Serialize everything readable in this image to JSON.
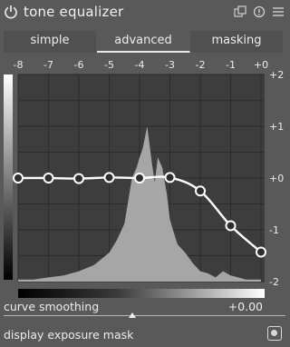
{
  "module": {
    "title": "tone equalizer"
  },
  "header_icons": [
    "power-icon",
    "presets-icon",
    "reset-icon",
    "menu-icon"
  ],
  "tabs": [
    {
      "label": "simple",
      "active": false
    },
    {
      "label": "advanced",
      "active": true
    },
    {
      "label": "masking",
      "active": false
    }
  ],
  "chart_data": {
    "type": "line",
    "x_ticks": [
      "-8",
      "-7",
      "-6",
      "-5",
      "-4",
      "-3",
      "-2",
      "-1",
      "+0"
    ],
    "y_ticks": [
      "+2",
      "+1",
      "+0",
      "-1",
      "-2"
    ],
    "xlim": [
      -8,
      0
    ],
    "ylim": [
      -2,
      2
    ],
    "grid": true,
    "series": [
      {
        "x": [
          -8,
          -7,
          -6,
          -5,
          -4,
          -3,
          -2,
          -1,
          0
        ],
        "values": [
          0,
          0,
          -0.01,
          0.01,
          0,
          0.01,
          -0.25,
          -0.92,
          -1.43
        ]
      }
    ],
    "histogram": {
      "x": [
        -8,
        -7.5,
        -7,
        -6.5,
        -6,
        -5.5,
        -5,
        -4.75,
        -4.5,
        -4.25,
        -4.1,
        -4,
        -3.9,
        -3.75,
        -3.6,
        -3.5,
        -3.4,
        -3.25,
        -3.1,
        -3,
        -2.9,
        -2.75,
        -2.5,
        -2.25,
        -2,
        -1.75,
        -1.5,
        -1.25,
        -1,
        -0.75,
        -0.5,
        -0.25,
        0
      ],
      "values": [
        0.01,
        0.01,
        0.02,
        0.03,
        0.05,
        0.08,
        0.14,
        0.2,
        0.28,
        0.5,
        0.55,
        0.6,
        0.64,
        0.75,
        0.58,
        0.48,
        0.6,
        0.55,
        0.42,
        0.3,
        0.25,
        0.18,
        0.14,
        0.09,
        0.05,
        0.04,
        0.02,
        0.05,
        0.03,
        0.02,
        0.01,
        0.01,
        0.01
      ]
    }
  },
  "curve_smoothing": {
    "label": "curve smoothing",
    "value": "+0.00"
  },
  "exposure_mask": {
    "label": "display exposure mask"
  }
}
